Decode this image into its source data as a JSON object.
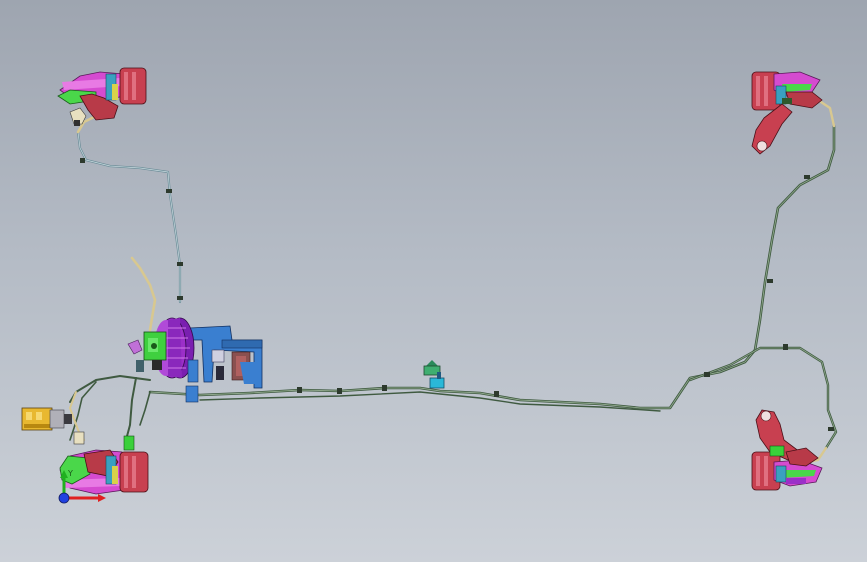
{
  "viewport": {
    "background_top": "#9ea5b0",
    "background_bottom": "#ccd1d8"
  },
  "palette": {
    "brake_line": "#3f5a40",
    "brake_line_highlight": "#8fa88c",
    "front_line": "#6f8f9a",
    "hose": "#d8c890",
    "clip": "#2d3a2d",
    "disc_magenta": "#d54bd0",
    "caliper_red": "#b83a48",
    "knuckle_red": "#c84050",
    "bracket_green": "#4ad74a",
    "booster_purple": "#9b2fc8",
    "master_cyl_green": "#3fd03f",
    "pedal_box_blue": "#3a7fd0",
    "abs_yellow": "#e8b830",
    "valve_cyan": "#2ab8d8",
    "triad_x": "#e02020",
    "triad_y": "#20b020",
    "triad_z": "#2040e0"
  },
  "scene": {
    "assemblies": [
      "front-left-brake-corner",
      "front-right-brake-corner",
      "rear-left-brake-corner",
      "rear-right-brake-corner",
      "brake-booster",
      "master-cylinder",
      "pedal-box",
      "abs-module",
      "proportioning-valve",
      "brake-lines"
    ]
  },
  "triad": {
    "axis_label": "Y"
  }
}
